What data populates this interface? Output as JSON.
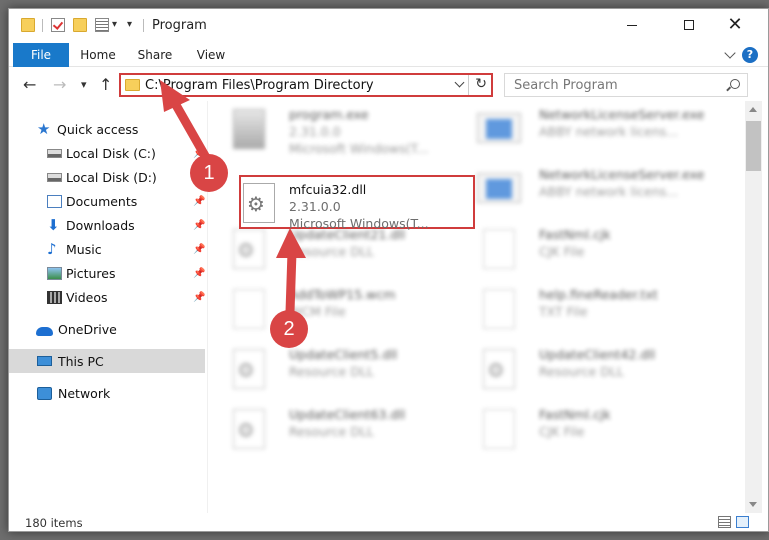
{
  "window": {
    "title": "Program"
  },
  "ribbon": {
    "tabs": [
      {
        "label": "File"
      },
      {
        "label": "Home"
      },
      {
        "label": "Share"
      },
      {
        "label": "View"
      }
    ],
    "help_label": "?"
  },
  "navigation": {
    "back": "←",
    "forward": "→",
    "recent": "▾",
    "up": "↑",
    "address": "C:\\Program Files\\Program Directory",
    "refresh": "↻",
    "search_placeholder": "Search Program"
  },
  "sidebar": {
    "items": [
      {
        "label": "Quick access"
      },
      {
        "label": "Local Disk (C:)"
      },
      {
        "label": "Local Disk (D:)"
      },
      {
        "label": "Documents"
      },
      {
        "label": "Downloads"
      },
      {
        "label": "Music"
      },
      {
        "label": "Pictures"
      },
      {
        "label": "Videos"
      },
      {
        "label": "OneDrive"
      },
      {
        "label": "This PC"
      },
      {
        "label": "Network"
      }
    ],
    "selected": "This PC"
  },
  "files": {
    "items": [
      {
        "name": "program.exe",
        "line1": "2.31.0.0",
        "line2": "Microsoft Windows(T..."
      },
      {
        "name": "NetworkLicenseServer.exe",
        "line1": "ABBY network licens..."
      },
      {
        "name": "mfcuia32.dll",
        "line1": "2.31.0.0",
        "line2": "Microsoft Windows(T..."
      },
      {
        "name": "NetworkLicenseServer.exe",
        "line1": "ABBY network licens..."
      },
      {
        "name": "UpdateClient21.dll",
        "line1": "Resource DLL"
      },
      {
        "name": "FastNml.cjk",
        "line1": "CJK File"
      },
      {
        "name": "AddToWP15.wcm",
        "line1": "WCM File"
      },
      {
        "name": "help.fineReader.txt",
        "line1": "TXT File"
      },
      {
        "name": "UpdateClient5.dll",
        "line1": "Resource DLL"
      },
      {
        "name": "UpdateClient42.dll",
        "line1": "Resource DLL"
      },
      {
        "name": "UpdateClient63.dll",
        "line1": "Resource DLL"
      },
      {
        "name": "FastNml.cjk",
        "line1": "CJK File"
      }
    ],
    "highlighted": "mfcuia32.dll"
  },
  "status": {
    "item_count": "180 items"
  },
  "annotations": {
    "callout_1": "1",
    "callout_2": "2",
    "color": "#d94545"
  }
}
